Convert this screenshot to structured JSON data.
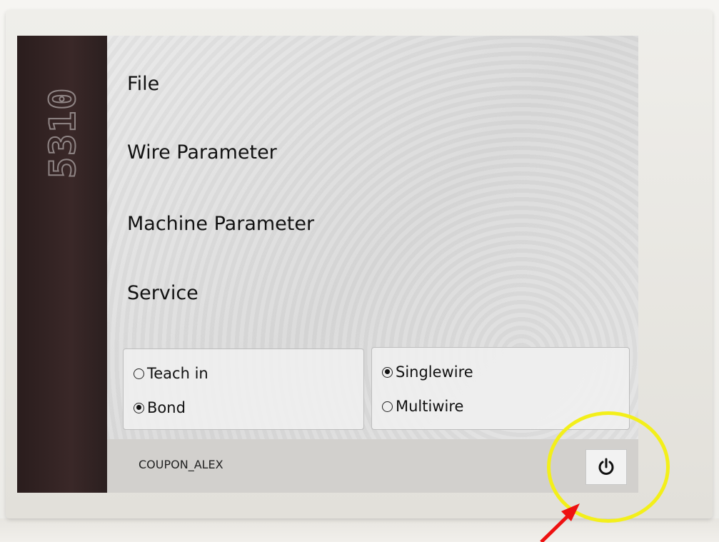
{
  "device": {
    "model_label": "5310"
  },
  "menu": {
    "items": [
      {
        "label": "File"
      },
      {
        "label": "Wire Parameter"
      },
      {
        "label": "Machine Parameter"
      },
      {
        "label": "Service"
      }
    ]
  },
  "mode_group": {
    "options": [
      {
        "label": "Teach in",
        "selected": false
      },
      {
        "label": "Bond",
        "selected": true
      }
    ]
  },
  "wire_group": {
    "options": [
      {
        "label": "Singlewire",
        "selected": true
      },
      {
        "label": "Multiwire",
        "selected": false
      }
    ]
  },
  "status_bar": {
    "current_file": "COUPON_ALEX"
  },
  "power_button": {
    "icon": "power-icon"
  },
  "annotation": {
    "circle_color": "#f3ef1a",
    "arrow_color": "#ee1111"
  }
}
